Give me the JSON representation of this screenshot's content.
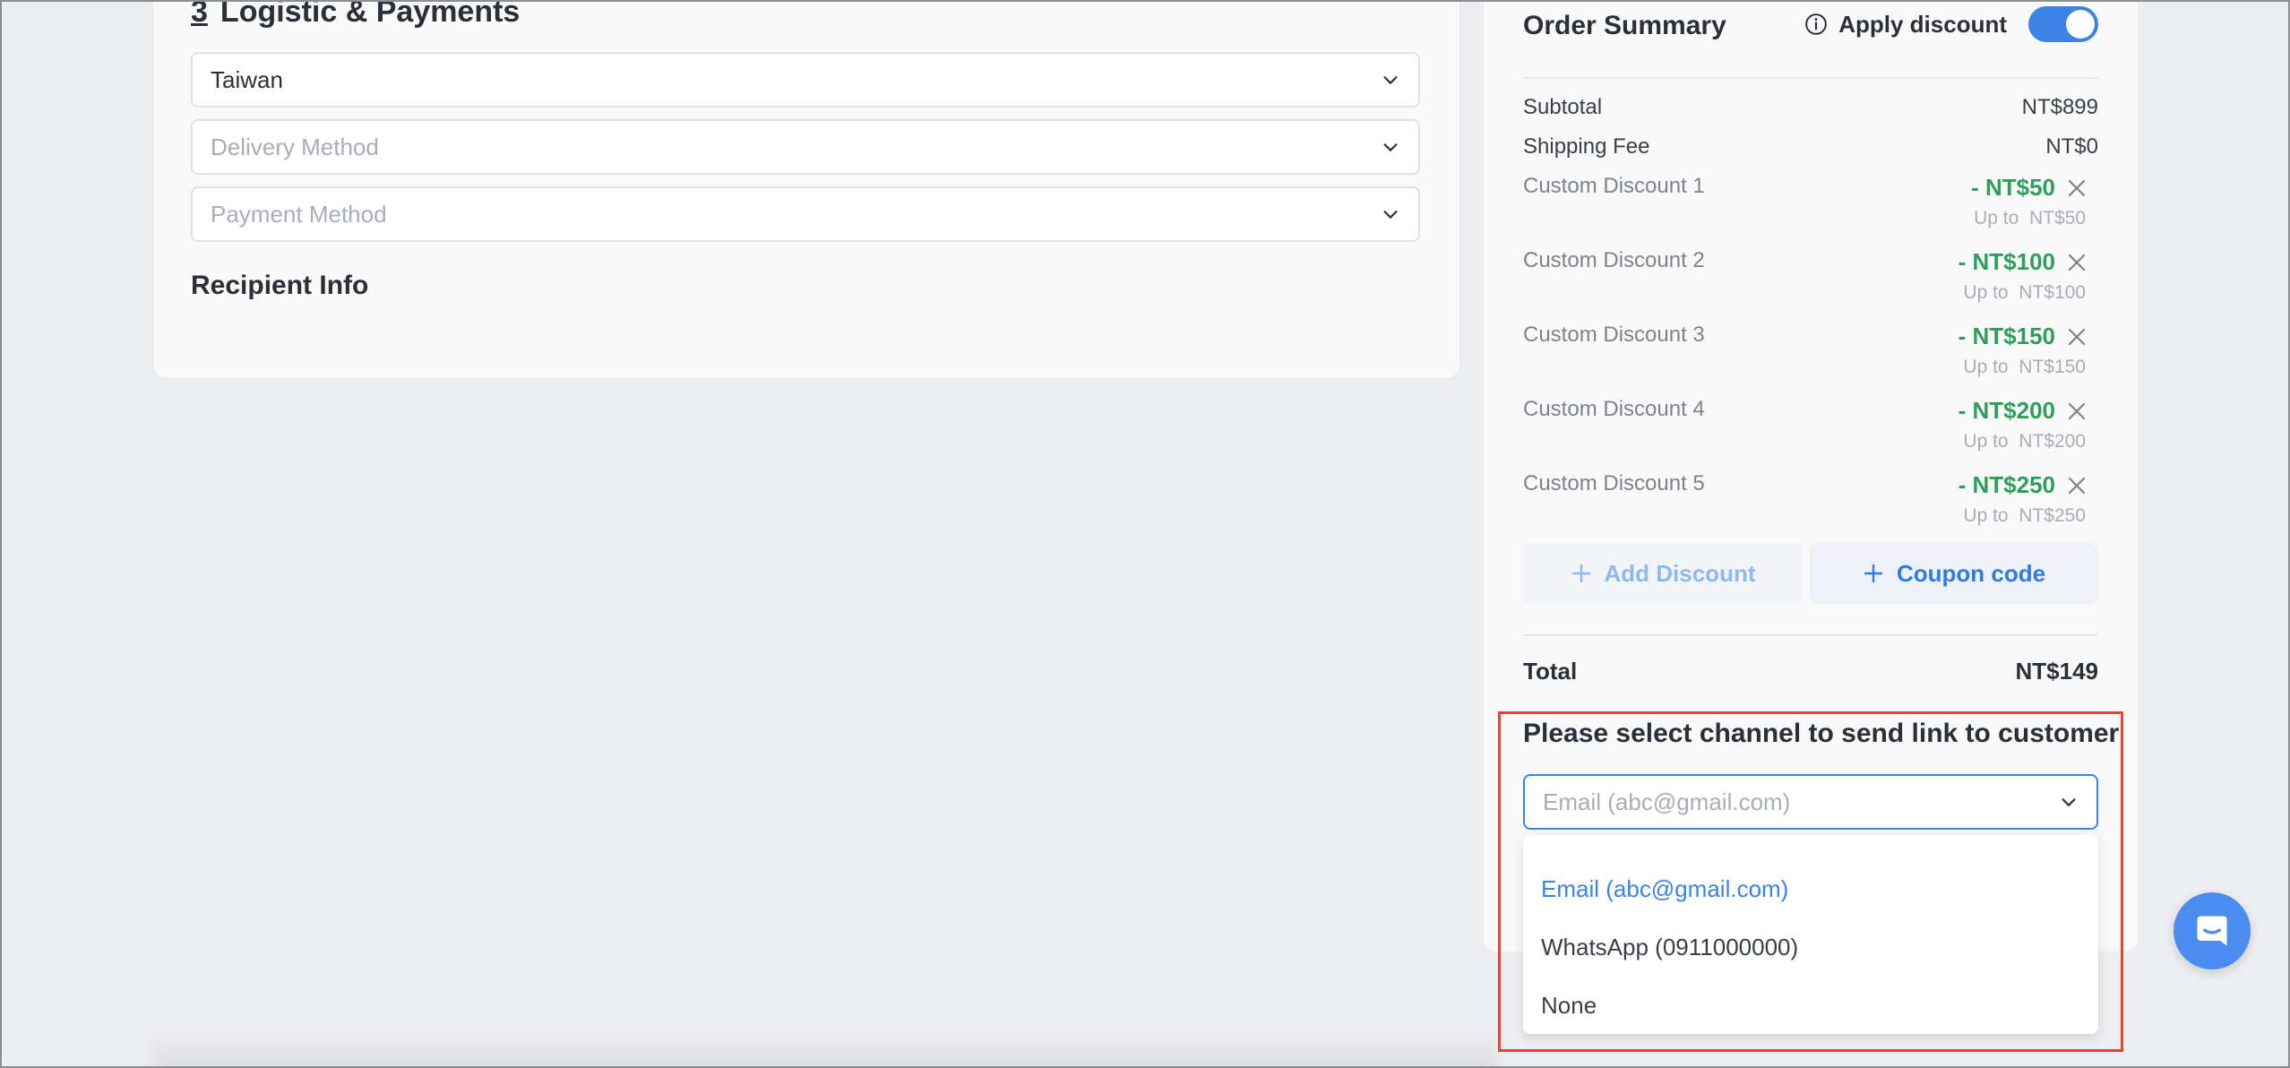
{
  "logistics": {
    "section_number": "3",
    "title": "Logistic & Payments",
    "country_value": "Taiwan",
    "delivery_placeholder": "Delivery Method",
    "payment_placeholder": "Payment Method",
    "recipient_title": "Recipient Info"
  },
  "order_summary": {
    "title": "Order Summary",
    "apply_discount_label": "Apply discount",
    "apply_discount_on": true,
    "subtotal_label": "Subtotal",
    "subtotal_value": "NT$899",
    "shipping_label": "Shipping Fee",
    "shipping_value": "NT$0",
    "discounts": [
      {
        "name": "Custom Discount 1",
        "amount": "- NT$50",
        "upto_label": "Up to",
        "upto_value": "NT$50"
      },
      {
        "name": "Custom Discount 2",
        "amount": "- NT$100",
        "upto_label": "Up to",
        "upto_value": "NT$100"
      },
      {
        "name": "Custom Discount 3",
        "amount": "- NT$150",
        "upto_label": "Up to",
        "upto_value": "NT$150"
      },
      {
        "name": "Custom Discount 4",
        "amount": "- NT$200",
        "upto_label": "Up to",
        "upto_value": "NT$200"
      },
      {
        "name": "Custom Discount 5",
        "amount": "- NT$250",
        "upto_label": "Up to",
        "upto_value": "NT$250"
      }
    ],
    "add_discount_label": "Add Discount",
    "coupon_label": "Coupon code",
    "total_label": "Total",
    "total_value": "NT$149"
  },
  "channel": {
    "title": "Please select channel to send link to customer",
    "placeholder": "Email (abc@gmail.com)",
    "options": [
      "Email (abc@gmail.com)",
      "WhatsApp (0911000000)",
      "None"
    ],
    "selected_index": 0
  },
  "colors": {
    "accent": "#3b83e6",
    "discount_green": "#2e9e5b",
    "highlight_red": "#e8432d"
  }
}
